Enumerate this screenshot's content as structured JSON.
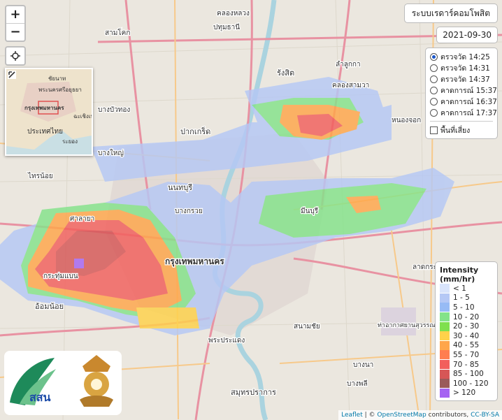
{
  "title": "ระบบเรดาร์คอมโพสิต",
  "date": "2021-09-30",
  "zoom": {
    "in_label": "+",
    "out_label": "−"
  },
  "locate_icon": "crosshair-icon",
  "layers": [
    {
      "label": "ตรวจวัด 14:25",
      "selected": true
    },
    {
      "label": "ตรวจวัด 14:31",
      "selected": false
    },
    {
      "label": "ตรวจวัด 14:37",
      "selected": false
    },
    {
      "label": "คาดการณ์ 15:37",
      "selected": false
    },
    {
      "label": "คาดการณ์ 16:37",
      "selected": false
    },
    {
      "label": "คาดการณ์ 17:37",
      "selected": false
    }
  ],
  "risk_checkbox": {
    "label": "พื้นที่เสี่ยง",
    "checked": false
  },
  "legend": {
    "title": "Intensity",
    "unit": "(mm/hr)",
    "items": [
      {
        "label": "< 1",
        "color": "#d9e4fb"
      },
      {
        "label": "1 - 5",
        "color": "#b5c8f5"
      },
      {
        "label": "5 - 10",
        "color": "#97bbf5"
      },
      {
        "label": "10 - 20",
        "color": "#84e38a"
      },
      {
        "label": "20 - 30",
        "color": "#7fe04e"
      },
      {
        "label": "30 - 40",
        "color": "#ffd24a"
      },
      {
        "label": "40 - 55",
        "color": "#ffa64a"
      },
      {
        "label": "55 - 70",
        "color": "#ff7e50"
      },
      {
        "label": "70 - 85",
        "color": "#f25f5c"
      },
      {
        "label": "85 - 100",
        "color": "#d65656"
      },
      {
        "label": "100 - 120",
        "color": "#9a5a5a"
      },
      {
        "label": "> 120",
        "color": "#a563f2"
      }
    ]
  },
  "minimap_labels": {
    "a": "ชัยนาท",
    "b": "พระนครศรีอยุธยา",
    "c": "กรุงเทพมหานคร",
    "d": "ฉะเชิงเทรา",
    "e": "ประเทศไทย",
    "f": "ระยอง"
  },
  "map_labels": {
    "rangsit": "รังสิต",
    "pathumthani": "ปทุมธานี",
    "pakkret": "ปากเกร็ด",
    "nonthaburi": "นนทบุรี",
    "bangkok": "กรุงเทพมหานคร",
    "samutprakan": "สมุทรปราการ",
    "omnoi": "อ้อมน้อย",
    "krathumbaen": "กระทุ่มแบน",
    "salaya": "ศาลายา",
    "bangyai": "บางใหญ่",
    "bangbuathong": "บางบัวทอง",
    "lamlukka": "ลำลูกกา",
    "bangphli": "บางพลี",
    "phrapradaeng": "พระประแดง",
    "suvarnabhumi": "ท่าอากาศยานสุวรรณภูมิ",
    "lat_krabang": "ลาดกระบัง",
    "nongchok": "หนองจอก",
    "khlongluang": "คลองหลวง",
    "samkhok": "สามโคก",
    "bangkruai": "บางกรวย",
    "sainoi": "ไทรน้อย",
    "khlongsamwa": "คลองสามวา",
    "minburi": "มีนบุรี",
    "bangna": "บางนา",
    "sanamchai": "สนามชัย"
  },
  "attribution": {
    "leaflet": "Leaflet",
    "sep": " | © ",
    "osm": "OpenStreetMap",
    "contrib": " contributors, ",
    "license": "CC-BY-SA"
  },
  "logo": {
    "text": "สสน"
  }
}
